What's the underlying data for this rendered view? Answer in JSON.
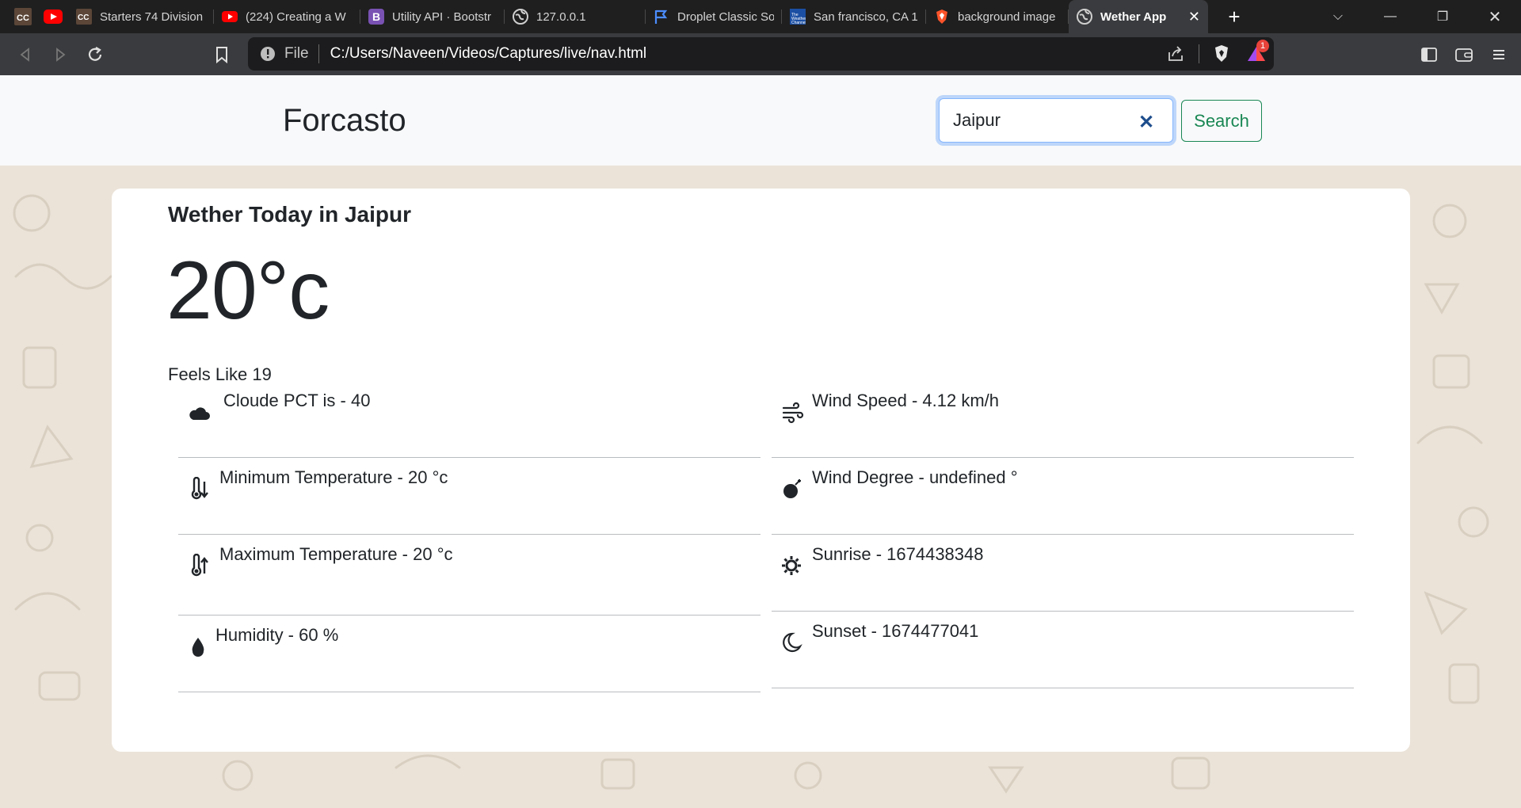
{
  "browser": {
    "tabs": [
      {
        "label": "Starters 74 Division",
        "icon": "codechef-icon"
      },
      {
        "label": "(224) Creating a W",
        "icon": "youtube-icon"
      },
      {
        "label": "Utility API · Bootstr",
        "icon": "bootstrap-icon"
      },
      {
        "label": "127.0.0.1",
        "icon": "globe-icon"
      },
      {
        "label": "Droplet Classic Sol",
        "icon": "flag-icon"
      },
      {
        "label": "San francisco, CA 1",
        "icon": "weather-channel-icon"
      },
      {
        "label": "background image",
        "icon": "brave-icon"
      },
      {
        "label": "Wether App",
        "icon": "globe-icon",
        "active": true
      }
    ],
    "address_scheme": "File",
    "address_url": "C:/Users/Naveen/Videos/Captures/live/nav.html",
    "rewards_badge": "1"
  },
  "navbar": {
    "brand": "Forcasto",
    "search_value": "Jaipur",
    "search_button": "Search"
  },
  "weather": {
    "title": "Wether Today in Jaipur",
    "temperature": "20°c",
    "feels_like": "Feels Like 19",
    "left_items": [
      {
        "icon": "cloud-icon",
        "text": "Cloude PCT is - 40"
      },
      {
        "icon": "thermometer-low-icon",
        "text": "Minimum Temperature - 20 °c"
      },
      {
        "icon": "thermometer-high-icon",
        "text": "Maximum Temperature - 20 °c"
      },
      {
        "icon": "droplet-icon",
        "text": "Humidity - 60 %"
      }
    ],
    "right_items": [
      {
        "icon": "wind-icon",
        "text": "Wind Speed - 4.12 km/h"
      },
      {
        "icon": "compass-icon",
        "text": "Wind Degree - undefined °"
      },
      {
        "icon": "sun-icon",
        "text": "Sunrise - 1674438348"
      },
      {
        "icon": "moon-icon",
        "text": "Sunset - 1674477041"
      }
    ]
  },
  "colors": {
    "accent_success": "#198754",
    "focus_border": "#86b7fe",
    "page_background": "#ebe3d8"
  }
}
